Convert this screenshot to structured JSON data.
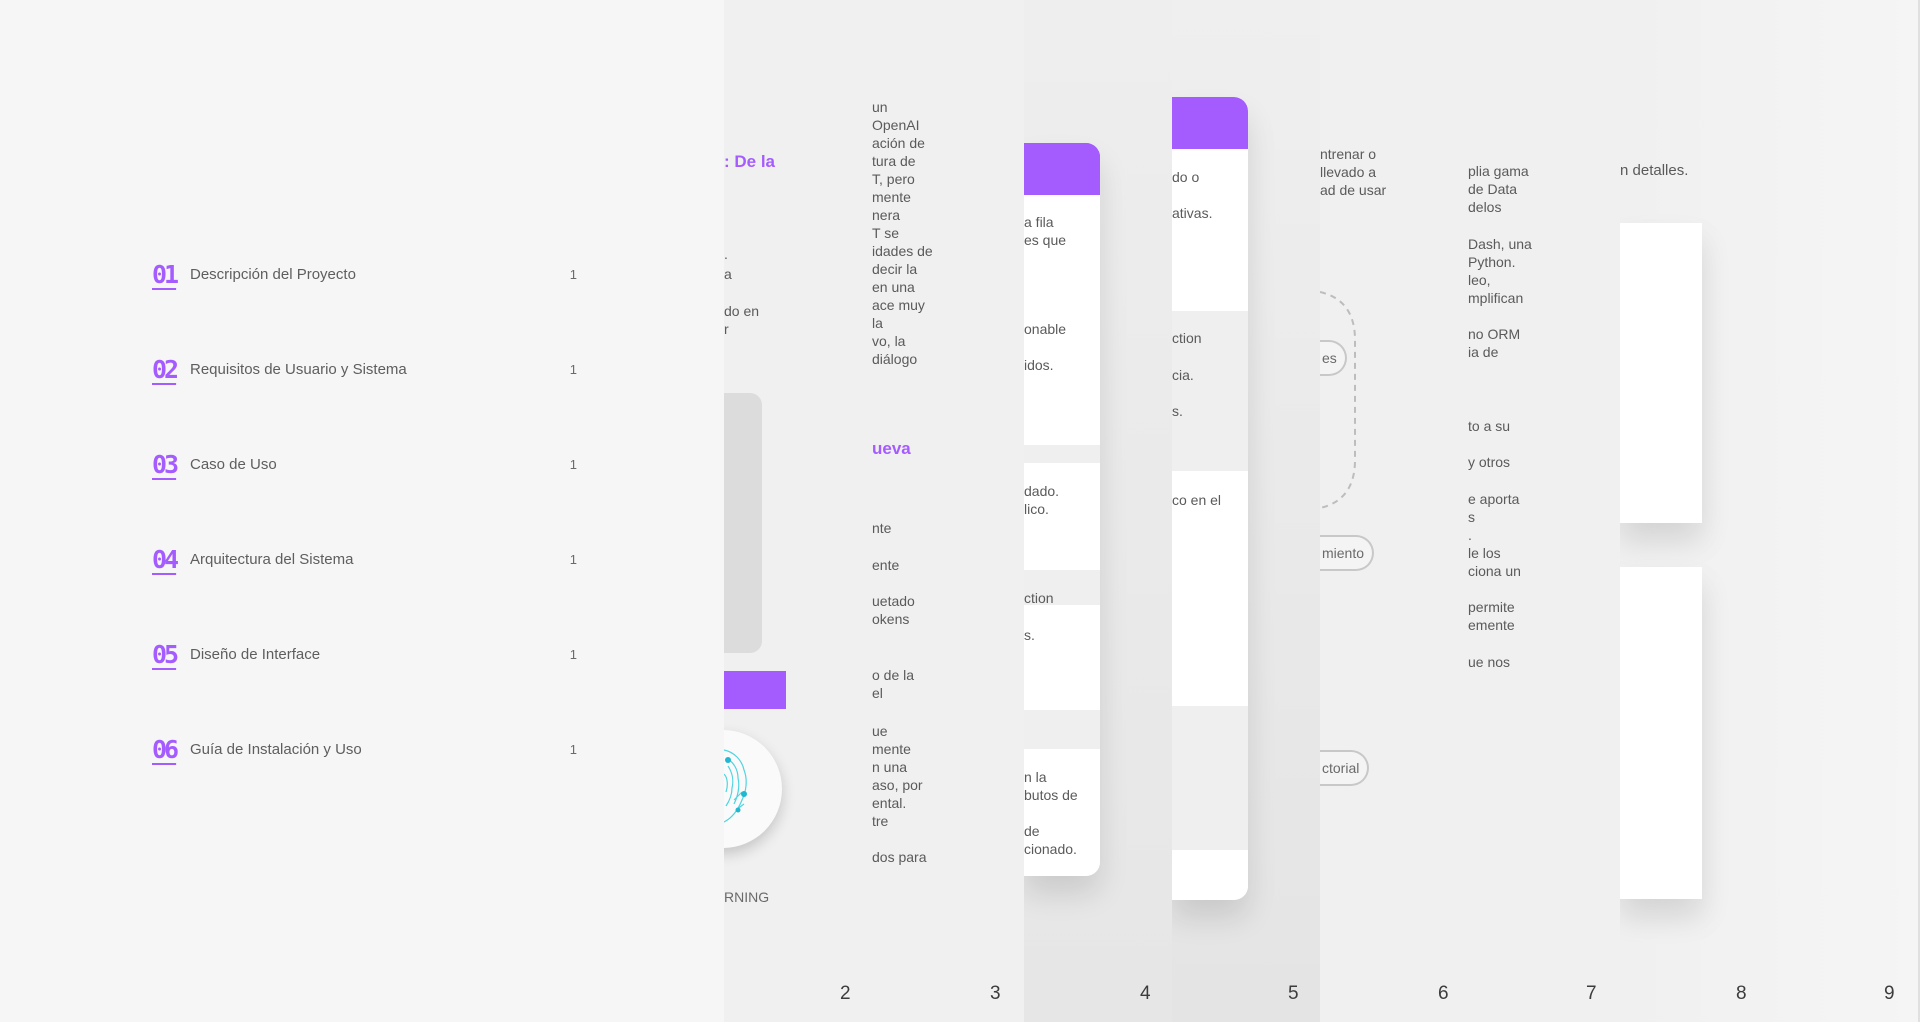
{
  "toc": [
    {
      "num": "01",
      "title": "Descripción del Proyecto",
      "page": "1"
    },
    {
      "num": "02",
      "title": "Requisitos de Usuario y Sistema",
      "page": "1"
    },
    {
      "num": "03",
      "title": "Caso de Uso",
      "page": "1"
    },
    {
      "num": "04",
      "title": "Arquitectura del Sistema",
      "page": "1"
    },
    {
      "num": "05",
      "title": "Diseño de Interface",
      "page": "1"
    },
    {
      "num": "06",
      "title": "Guía de Instalación y Uso",
      "page": "1"
    }
  ],
  "strip1": {
    "heading": ": De la",
    "frag1": ".",
    "frag2": "a",
    "frag3": "do en",
    "frag4": "r",
    "caption": "RNING"
  },
  "strip2": {
    "para1": [
      "un",
      "OpenAI",
      "ación de",
      "tura de",
      "T, pero",
      "mente",
      "nera",
      "T se",
      "idades de",
      "decir la",
      "en una",
      "ace muy",
      "la",
      "vo, la",
      "diálogo"
    ],
    "heading": "ueva",
    "items": [
      "nte",
      "ente",
      "uetado",
      "okens",
      "o de la",
      "el",
      "ue",
      "mente",
      "n una",
      "aso, por",
      "ental.",
      "tre",
      "dos para"
    ]
  },
  "strip3": {
    "c1": [
      "a fila",
      "es que"
    ],
    "c2": "onable",
    "c3": "idos.",
    "c4": [
      "dado.",
      "lico."
    ],
    "c5": "ction",
    "c6": "s.",
    "c7": [
      "n la",
      "butos de"
    ],
    "c8": [
      "de",
      "cionado."
    ]
  },
  "strip4": {
    "c1": "do o",
    "c2": "ativas.",
    "c3": "ction",
    "c4": "cia.",
    "c5": "s.",
    "c6": "co en el"
  },
  "strip5": {
    "lines": [
      "ntrenar o",
      "llevado a",
      "ad de usar"
    ],
    "pill1": "es",
    "pill2": "miento",
    "pill3": "ctorial"
  },
  "strip6": {
    "lines": [
      "plia gama",
      "de Data",
      "delos",
      "Dash, una",
      "Python.",
      "leo,",
      "mplifican",
      "no ORM",
      "ia de",
      "to a su",
      "y otros",
      "e aporta",
      "s",
      ".",
      "le los",
      "ciona un",
      "permite",
      "emente",
      "ue nos"
    ]
  },
  "strip7": {
    "text": "n detalles."
  },
  "page_numbers": [
    "2",
    "3",
    "4",
    "5",
    "6",
    "7",
    "8",
    "9"
  ],
  "colors": {
    "accent": "#a55cff",
    "background": "#f0f0f0",
    "toc_background": "#f6f6f6"
  }
}
